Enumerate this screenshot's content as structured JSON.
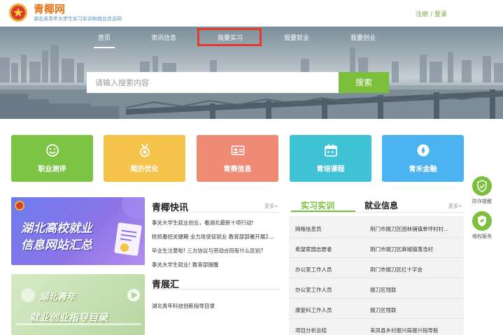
{
  "header": {
    "logo_title": "青椰网",
    "logo_subtitle": "湖北省青年大学生实习实训和就业信息网",
    "register": "注册",
    "separator": "/",
    "login": "登录"
  },
  "nav": {
    "items": [
      {
        "label": "首页",
        "active": true
      },
      {
        "label": "资讯信息",
        "active": false
      },
      {
        "label": "我要实习",
        "active": false,
        "highlighted": true
      },
      {
        "label": "我要就业",
        "active": false
      },
      {
        "label": "我要创业",
        "active": false
      }
    ],
    "highlight_color": "#e23b2e"
  },
  "search": {
    "placeholder": "请输入搜索内容",
    "button": "搜索",
    "button_color": "#7bbf3a"
  },
  "tiles": [
    {
      "label": "职业测评",
      "icon": "smiley-icon",
      "color": "#7cc443"
    },
    {
      "label": "简历优化",
      "icon": "medal-icon",
      "color": "#f5c24a"
    },
    {
      "label": "青赛信息",
      "icon": "id-card-icon",
      "color": "#ef8a74"
    },
    {
      "label": "青培课程",
      "icon": "calendar-icon",
      "color": "#3fc2d4"
    },
    {
      "label": "青禾金融",
      "icon": "coin-icon",
      "color": "#4bb3f0"
    }
  ],
  "banners": {
    "gaoxiao_line1": "湖北高校就业",
    "gaoxiao_line2": "信息网站汇总",
    "qingnian_line1": "湖北青年",
    "qingnian_line2": "就业创业指导目录"
  },
  "qingye_news": {
    "title": "青椰快讯",
    "more": "更多>",
    "items": [
      "事关大学生就业创业，看湖北最新十项行动!",
      "抢抓春招关键期 全力攻坚促就业 教育部部署开展2...",
      "毕业生注意啦! 三方协议与劳动合同有什么区别?",
      "事关大学生就业! 教育部提醒"
    ]
  },
  "qingzhan": {
    "title": "青展汇",
    "items": [
      "湖北青年科技创新指导目录"
    ]
  },
  "right_tabs": {
    "shixi": "实习实训",
    "jiuye": "就业信息",
    "more": "更多>",
    "active_color": "#7bbf3a"
  },
  "shixi_list": [
    {
      "title": "网格信息员",
      "location": "荆门市掇刀区团林铺镇单坪村村..."
    },
    {
      "title": "希望家园志愿者",
      "location": "荆门市掇刀区麻城镇落浩村"
    },
    {
      "title": "办公室工作人员",
      "location": "荆门市掇刀区红十字会"
    },
    {
      "title": "办公室工作人员",
      "location": "掇刀区残联"
    },
    {
      "title": "康复科工作人员",
      "location": "掇刀区残联"
    },
    {
      "title": "项目分析总结",
      "location": "来凤县乡村振兴局振兴指导股"
    }
  ],
  "floating": [
    {
      "label": "防诈提醒",
      "icon": "shield-check-icon"
    },
    {
      "label": "维权服务",
      "icon": "shield-leaf-icon"
    }
  ]
}
